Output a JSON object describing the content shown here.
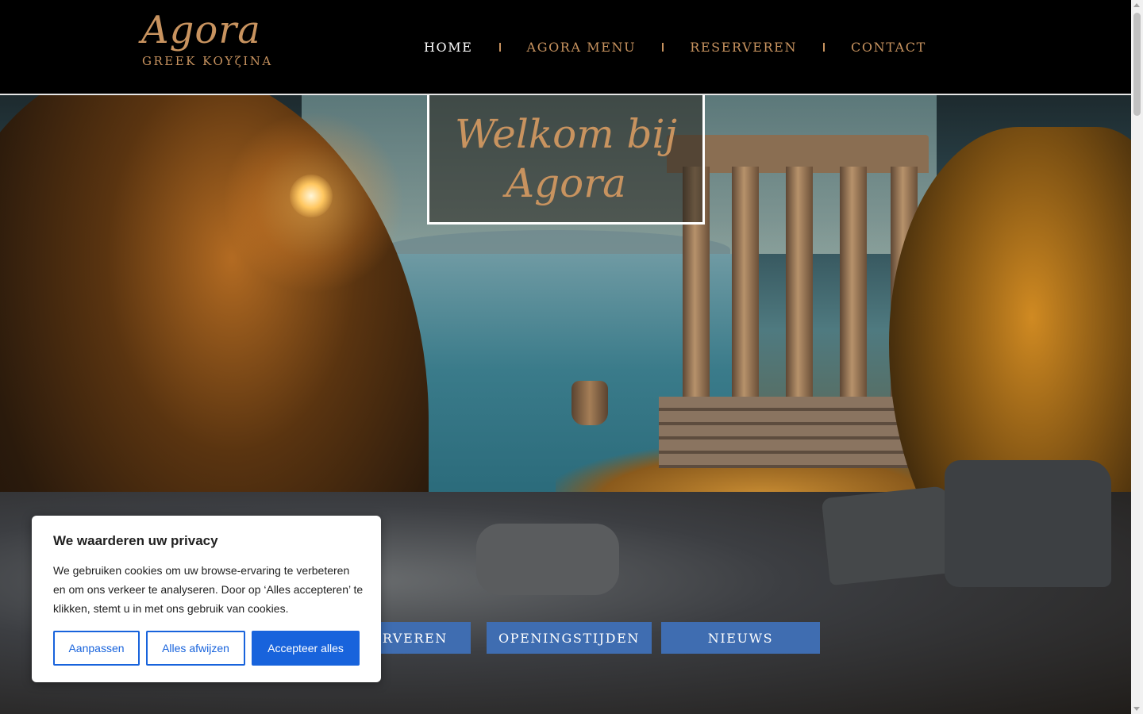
{
  "header": {
    "logo_title": "Agora",
    "logo_subtitle": "GREEK KOYζINA",
    "nav": [
      {
        "label": "HOME",
        "active": true
      },
      {
        "label": "AGORA MENU"
      },
      {
        "label": "RESERVEREN"
      },
      {
        "label": "CONTACT"
      }
    ]
  },
  "hero": {
    "welcome_text": "Welkom bij Agora",
    "buttons": [
      "RESERVEREN",
      "OPENINGSTIJDEN",
      "NIEUWS"
    ]
  },
  "cookie_banner": {
    "title": "We waarderen uw privacy",
    "text": "We gebruiken cookies om uw browse-ervaring te verbeteren en om ons verkeer te analyseren. Door op ‘Alles accepteren’ te klikken, stemt u in met ons gebruik van cookies.",
    "customize_label": "Aanpassen",
    "reject_label": "Alles afwijzen",
    "accept_label": "Accepteer alles"
  },
  "colors": {
    "accent": "#c8935f",
    "hero_button": "#3f6db1",
    "cookie_primary": "#1863dc"
  }
}
